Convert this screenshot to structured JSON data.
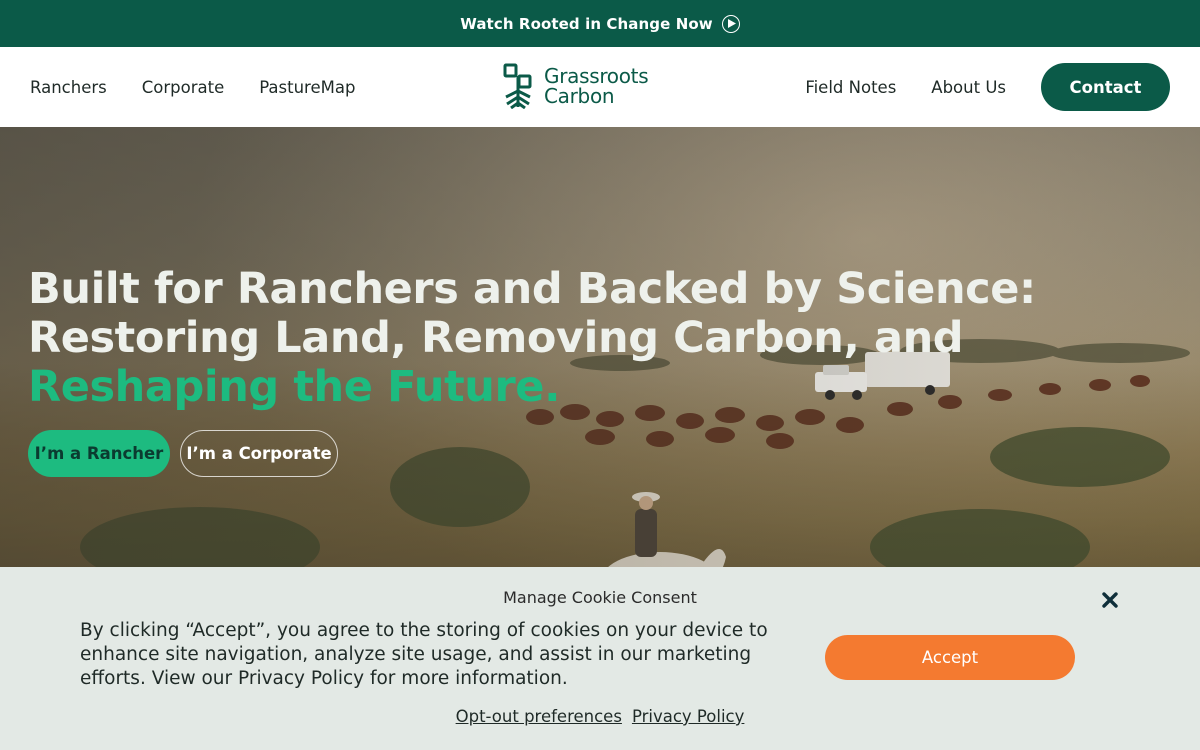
{
  "banner": {
    "text": "Watch Rooted in Change Now",
    "icon": "play-circle-icon"
  },
  "nav": {
    "left": [
      "Ranchers",
      "Corporate",
      "PastureMap"
    ],
    "right": [
      "Field Notes",
      "About Us"
    ],
    "contact_label": "Contact",
    "logo_line1": "Grassroots",
    "logo_line2": "Carbon"
  },
  "hero": {
    "title_part1": "Built for Ranchers and Backed by Science: Restoring Land, Removing Carbon, and ",
    "title_accent": "Reshaping the Future.",
    "btn_rancher": "I’m a Rancher",
    "btn_corporate": "I’m a Corporate"
  },
  "cookie": {
    "title": "Manage Cookie Consent",
    "text": "By clicking “Accept”, you agree to the storing of cookies on your device to enhance site navigation, analyze site usage, and assist in our marketing efforts. View our Privacy Policy for more information.",
    "accept": "Accept",
    "link_optout": "Opt-out preferences",
    "link_privacy": "Privacy Policy"
  },
  "colors": {
    "brand_dark_green": "#0b5a48",
    "accent_green": "#1dbb80",
    "accept_orange": "#f47a30",
    "cookie_bg": "#e3e9e5"
  }
}
